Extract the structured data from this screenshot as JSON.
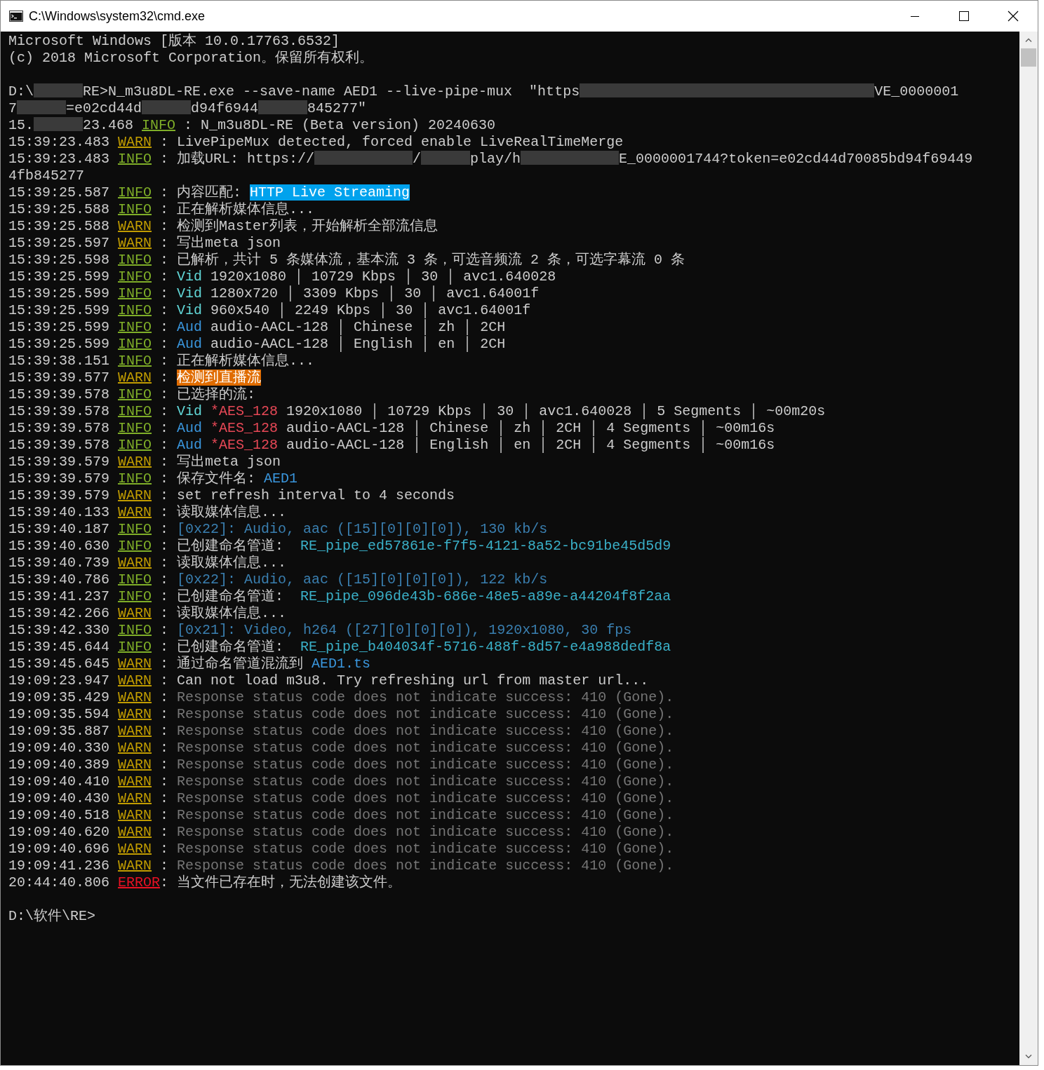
{
  "window": {
    "title": "C:\\Windows\\system32\\cmd.exe"
  },
  "console": {
    "blocks": [
      [
        {
          "segments": [
            {
              "kind": "txt",
              "text": "Microsoft Windows [版本 10.0.17763.6532]"
            }
          ]
        },
        {
          "segments": [
            {
              "kind": "txt",
              "text": "(c) 2018 Microsoft Corporation。保留所有权利。"
            }
          ]
        }
      ],
      [
        {
          "segments": [
            {
              "kind": "txt",
              "text": "D:\\"
            },
            {
              "kind": "redacted"
            },
            {
              "kind": "txt",
              "text": "RE>N_m3u8DL-RE.exe --save-name AED1 --live-pipe-mux  \"https"
            },
            {
              "kind": "redacted"
            },
            {
              "kind": "redacted"
            },
            {
              "kind": "redacted"
            },
            {
              "kind": "redacted"
            },
            {
              "kind": "redacted"
            },
            {
              "kind": "redacted"
            },
            {
              "kind": "txt",
              "text": "VE_0000001"
            }
          ]
        },
        {
          "segments": [
            {
              "kind": "txt",
              "text": "7"
            },
            {
              "kind": "redacted"
            },
            {
              "kind": "txt",
              "text": "=e02cd44d"
            },
            {
              "kind": "redacted"
            },
            {
              "kind": "txt",
              "text": "d94f6944"
            },
            {
              "kind": "redacted"
            },
            {
              "kind": "txt",
              "text": "845277\""
            }
          ]
        },
        {
          "segments": [
            {
              "kind": "txt",
              "text": "15."
            },
            {
              "kind": "redacted"
            },
            {
              "kind": "txt",
              "text": "23.468 "
            },
            {
              "kind": "info",
              "text": "INFO"
            },
            {
              "kind": "txt",
              "text": " : N_m3u8DL-RE (Beta version) 20240630"
            }
          ]
        },
        {
          "segments": [
            {
              "kind": "time",
              "text": "15:39:23.483 "
            },
            {
              "kind": "warn",
              "text": "WARN"
            },
            {
              "kind": "txt",
              "text": " : LivePipeMux detected, forced enable LiveRealTimeMerge"
            }
          ]
        },
        {
          "segments": [
            {
              "kind": "time",
              "text": "15:39:23.483 "
            },
            {
              "kind": "info",
              "text": "INFO"
            },
            {
              "kind": "txt",
              "text": " : 加载URL: https://"
            },
            {
              "kind": "redacted"
            },
            {
              "kind": "redacted"
            },
            {
              "kind": "txt",
              "text": "/"
            },
            {
              "kind": "redacted"
            },
            {
              "kind": "txt",
              "text": "play/h"
            },
            {
              "kind": "redacted"
            },
            {
              "kind": "redacted"
            },
            {
              "kind": "txt",
              "text": "E_0000001744?token=e02cd44d70085bd94f69449"
            }
          ]
        },
        {
          "segments": [
            {
              "kind": "txt",
              "text": "4fb845277"
            }
          ]
        },
        {
          "segments": [
            {
              "kind": "time",
              "text": "15:39:25.587 "
            },
            {
              "kind": "info",
              "text": "INFO"
            },
            {
              "kind": "txt",
              "text": " : 内容匹配: "
            },
            {
              "kind": "hl_blue",
              "text": "HTTP Live Streaming"
            }
          ]
        },
        {
          "segments": [
            {
              "kind": "time",
              "text": "15:39:25.588 "
            },
            {
              "kind": "info",
              "text": "INFO"
            },
            {
              "kind": "txt",
              "text": " : 正在解析媒体信息..."
            }
          ]
        },
        {
          "segments": [
            {
              "kind": "time",
              "text": "15:39:25.588 "
            },
            {
              "kind": "warn",
              "text": "WARN"
            },
            {
              "kind": "txt",
              "text": " : 检测到Master列表，开始解析全部流信息"
            }
          ]
        },
        {
          "segments": [
            {
              "kind": "time",
              "text": "15:39:25.597 "
            },
            {
              "kind": "warn",
              "text": "WARN"
            },
            {
              "kind": "txt",
              "text": " : 写出meta json"
            }
          ]
        },
        {
          "segments": [
            {
              "kind": "time",
              "text": "15:39:25.598 "
            },
            {
              "kind": "info",
              "text": "INFO"
            },
            {
              "kind": "txt",
              "text": " : 已解析，共计 5 条媒体流，基本流 3 条，可选音频流 2 条，可选字幕流 0 条"
            }
          ]
        },
        {
          "segments": [
            {
              "kind": "time",
              "text": "15:39:25.599 "
            },
            {
              "kind": "info",
              "text": "INFO"
            },
            {
              "kind": "txt",
              "text": " : "
            },
            {
              "kind": "vid",
              "text": "Vid"
            },
            {
              "kind": "txt",
              "text": " 1920x1080 │ 10729 Kbps │ 30 │ avc1.640028"
            }
          ]
        },
        {
          "segments": [
            {
              "kind": "time",
              "text": "15:39:25.599 "
            },
            {
              "kind": "info",
              "text": "INFO"
            },
            {
              "kind": "txt",
              "text": " : "
            },
            {
              "kind": "vid",
              "text": "Vid"
            },
            {
              "kind": "txt",
              "text": " 1280x720 │ 3309 Kbps │ 30 │ avc1.64001f"
            }
          ]
        },
        {
          "segments": [
            {
              "kind": "time",
              "text": "15:39:25.599 "
            },
            {
              "kind": "info",
              "text": "INFO"
            },
            {
              "kind": "txt",
              "text": " : "
            },
            {
              "kind": "vid",
              "text": "Vid"
            },
            {
              "kind": "txt",
              "text": " 960x540 │ 2249 Kbps │ 30 │ avc1.64001f"
            }
          ]
        },
        {
          "segments": [
            {
              "kind": "time",
              "text": "15:39:25.599 "
            },
            {
              "kind": "info",
              "text": "INFO"
            },
            {
              "kind": "txt",
              "text": " : "
            },
            {
              "kind": "aud",
              "text": "Aud"
            },
            {
              "kind": "txt",
              "text": " audio-AACL-128 │ Chinese │ zh │ 2CH"
            }
          ]
        },
        {
          "segments": [
            {
              "kind": "time",
              "text": "15:39:25.599 "
            },
            {
              "kind": "info",
              "text": "INFO"
            },
            {
              "kind": "txt",
              "text": " : "
            },
            {
              "kind": "aud",
              "text": "Aud"
            },
            {
              "kind": "txt",
              "text": " audio-AACL-128 │ English │ en │ 2CH"
            }
          ]
        },
        {
          "segments": [
            {
              "kind": "time",
              "text": "15:39:38.151 "
            },
            {
              "kind": "info",
              "text": "INFO"
            },
            {
              "kind": "txt",
              "text": " : 正在解析媒体信息..."
            }
          ]
        },
        {
          "segments": [
            {
              "kind": "time",
              "text": "15:39:39.577 "
            },
            {
              "kind": "warn",
              "text": "WARN"
            },
            {
              "kind": "txt",
              "text": " : "
            },
            {
              "kind": "hl_orange",
              "text": "检测到直播流"
            }
          ]
        },
        {
          "segments": [
            {
              "kind": "time",
              "text": "15:39:39.578 "
            },
            {
              "kind": "info",
              "text": "INFO"
            },
            {
              "kind": "txt",
              "text": " : 已选择的流:"
            }
          ]
        },
        {
          "segments": [
            {
              "kind": "time",
              "text": "15:39:39.578 "
            },
            {
              "kind": "info",
              "text": "INFO"
            },
            {
              "kind": "txt",
              "text": " : "
            },
            {
              "kind": "vid",
              "text": "Vid"
            },
            {
              "kind": "enc",
              "text": " *AES_128"
            },
            {
              "kind": "txt",
              "text": " 1920x1080 │ 10729 Kbps │ 30 │ avc1.640028 │ 5 Segments │ ~00m20s"
            }
          ]
        },
        {
          "segments": [
            {
              "kind": "time",
              "text": "15:39:39.578 "
            },
            {
              "kind": "info",
              "text": "INFO"
            },
            {
              "kind": "txt",
              "text": " : "
            },
            {
              "kind": "aud",
              "text": "Aud"
            },
            {
              "kind": "enc",
              "text": " *AES_128"
            },
            {
              "kind": "txt",
              "text": " audio-AACL-128 │ Chinese │ zh │ 2CH │ 4 Segments │ ~00m16s"
            }
          ]
        },
        {
          "segments": [
            {
              "kind": "time",
              "text": "15:39:39.578 "
            },
            {
              "kind": "info",
              "text": "INFO"
            },
            {
              "kind": "txt",
              "text": " : "
            },
            {
              "kind": "aud",
              "text": "Aud"
            },
            {
              "kind": "enc",
              "text": " *AES_128"
            },
            {
              "kind": "txt",
              "text": " audio-AACL-128 │ English │ en │ 2CH │ 4 Segments │ ~00m16s"
            }
          ]
        },
        {
          "segments": [
            {
              "kind": "time",
              "text": "15:39:39.579 "
            },
            {
              "kind": "warn",
              "text": "WARN"
            },
            {
              "kind": "txt",
              "text": " : 写出meta json"
            }
          ]
        },
        {
          "segments": [
            {
              "kind": "time",
              "text": "15:39:39.579 "
            },
            {
              "kind": "info",
              "text": "INFO"
            },
            {
              "kind": "txt",
              "text": " : 保存文件名: "
            },
            {
              "kind": "file",
              "text": "AED1"
            }
          ]
        },
        {
          "segments": [
            {
              "kind": "time",
              "text": "15:39:39.579 "
            },
            {
              "kind": "warn",
              "text": "WARN"
            },
            {
              "kind": "txt",
              "text": " : set refresh interval to 4 seconds"
            }
          ]
        },
        {
          "segments": [
            {
              "kind": "time",
              "text": "15:39:40.133 "
            },
            {
              "kind": "warn",
              "text": "WARN"
            },
            {
              "kind": "txt",
              "text": " : 读取媒体信息..."
            }
          ]
        },
        {
          "segments": [
            {
              "kind": "time",
              "text": "15:39:40.187 "
            },
            {
              "kind": "info",
              "text": "INFO"
            },
            {
              "kind": "txt",
              "text": " : "
            },
            {
              "kind": "meta",
              "text": "[0x22]: Audio, aac ([15][0][0][0]), 130 kb/s"
            }
          ]
        },
        {
          "segments": [
            {
              "kind": "time",
              "text": "15:39:40.630 "
            },
            {
              "kind": "info",
              "text": "INFO"
            },
            {
              "kind": "txt",
              "text": " : 已创建命名管道:  "
            },
            {
              "kind": "pipe",
              "text": "RE_pipe_ed57861e-f7f5-4121-8a52-bc91be45d5d9"
            }
          ]
        },
        {
          "segments": [
            {
              "kind": "time",
              "text": "15:39:40.739 "
            },
            {
              "kind": "warn",
              "text": "WARN"
            },
            {
              "kind": "txt",
              "text": " : 读取媒体信息..."
            }
          ]
        },
        {
          "segments": [
            {
              "kind": "time",
              "text": "15:39:40.786 "
            },
            {
              "kind": "info",
              "text": "INFO"
            },
            {
              "kind": "txt",
              "text": " : "
            },
            {
              "kind": "meta",
              "text": "[0x22]: Audio, aac ([15][0][0][0]), 122 kb/s"
            }
          ]
        },
        {
          "segments": [
            {
              "kind": "time",
              "text": "15:39:41.237 "
            },
            {
              "kind": "info",
              "text": "INFO"
            },
            {
              "kind": "txt",
              "text": " : 已创建命名管道:  "
            },
            {
              "kind": "pipe",
              "text": "RE_pipe_096de43b-686e-48e5-a89e-a44204f8f2aa"
            }
          ]
        },
        {
          "segments": [
            {
              "kind": "time",
              "text": "15:39:42.266 "
            },
            {
              "kind": "warn",
              "text": "WARN"
            },
            {
              "kind": "txt",
              "text": " : 读取媒体信息..."
            }
          ]
        },
        {
          "segments": [
            {
              "kind": "time",
              "text": "15:39:42.330 "
            },
            {
              "kind": "info",
              "text": "INFO"
            },
            {
              "kind": "txt",
              "text": " : "
            },
            {
              "kind": "meta",
              "text": "[0x21]: Video, h264 ([27][0][0][0]), 1920x1080, 30 fps"
            }
          ]
        },
        {
          "segments": [
            {
              "kind": "time",
              "text": "15:39:45.644 "
            },
            {
              "kind": "info",
              "text": "INFO"
            },
            {
              "kind": "txt",
              "text": " : 已创建命名管道:  "
            },
            {
              "kind": "pipe",
              "text": "RE_pipe_b404034f-5716-488f-8d57-e4a988dedf8a"
            }
          ]
        },
        {
          "segments": [
            {
              "kind": "time",
              "text": "15:39:45.645 "
            },
            {
              "kind": "warn",
              "text": "WARN"
            },
            {
              "kind": "txt",
              "text": " : 通过命名管道混流到 "
            },
            {
              "kind": "file",
              "text": "AED1.ts"
            }
          ]
        },
        {
          "segments": [
            {
              "kind": "time",
              "text": "19:09:23.947 "
            },
            {
              "kind": "warn",
              "text": "WARN"
            },
            {
              "kind": "txt",
              "text": " : Can not load m3u8. Try refreshing url from master url..."
            }
          ]
        },
        {
          "segments": [
            {
              "kind": "time",
              "text": "19:09:35.429 "
            },
            {
              "kind": "warn",
              "text": "WARN"
            },
            {
              "kind": "txt",
              "text": " : "
            },
            {
              "kind": "dim",
              "text": "Response status code does not indicate success: 410 (Gone)."
            }
          ]
        },
        {
          "segments": [
            {
              "kind": "time",
              "text": "19:09:35.594 "
            },
            {
              "kind": "warn",
              "text": "WARN"
            },
            {
              "kind": "txt",
              "text": " : "
            },
            {
              "kind": "dim",
              "text": "Response status code does not indicate success: 410 (Gone)."
            }
          ]
        },
        {
          "segments": [
            {
              "kind": "time",
              "text": "19:09:35.887 "
            },
            {
              "kind": "warn",
              "text": "WARN"
            },
            {
              "kind": "txt",
              "text": " : "
            },
            {
              "kind": "dim",
              "text": "Response status code does not indicate success: 410 (Gone)."
            }
          ]
        },
        {
          "segments": [
            {
              "kind": "time",
              "text": "19:09:40.330 "
            },
            {
              "kind": "warn",
              "text": "WARN"
            },
            {
              "kind": "txt",
              "text": " : "
            },
            {
              "kind": "dim",
              "text": "Response status code does not indicate success: 410 (Gone)."
            }
          ]
        },
        {
          "segments": [
            {
              "kind": "time",
              "text": "19:09:40.389 "
            },
            {
              "kind": "warn",
              "text": "WARN"
            },
            {
              "kind": "txt",
              "text": " : "
            },
            {
              "kind": "dim",
              "text": "Response status code does not indicate success: 410 (Gone)."
            }
          ]
        },
        {
          "segments": [
            {
              "kind": "time",
              "text": "19:09:40.410 "
            },
            {
              "kind": "warn",
              "text": "WARN"
            },
            {
              "kind": "txt",
              "text": " : "
            },
            {
              "kind": "dim",
              "text": "Response status code does not indicate success: 410 (Gone)."
            }
          ]
        },
        {
          "segments": [
            {
              "kind": "time",
              "text": "19:09:40.430 "
            },
            {
              "kind": "warn",
              "text": "WARN"
            },
            {
              "kind": "txt",
              "text": " : "
            },
            {
              "kind": "dim",
              "text": "Response status code does not indicate success: 410 (Gone)."
            }
          ]
        },
        {
          "segments": [
            {
              "kind": "time",
              "text": "19:09:40.518 "
            },
            {
              "kind": "warn",
              "text": "WARN"
            },
            {
              "kind": "txt",
              "text": " : "
            },
            {
              "kind": "dim",
              "text": "Response status code does not indicate success: 410 (Gone)."
            }
          ]
        },
        {
          "segments": [
            {
              "kind": "time",
              "text": "19:09:40.620 "
            },
            {
              "kind": "warn",
              "text": "WARN"
            },
            {
              "kind": "txt",
              "text": " : "
            },
            {
              "kind": "dim",
              "text": "Response status code does not indicate success: 410 (Gone)."
            }
          ]
        },
        {
          "segments": [
            {
              "kind": "time",
              "text": "19:09:40.696 "
            },
            {
              "kind": "warn",
              "text": "WARN"
            },
            {
              "kind": "txt",
              "text": " : "
            },
            {
              "kind": "dim",
              "text": "Response status code does not indicate success: 410 (Gone)."
            }
          ]
        },
        {
          "segments": [
            {
              "kind": "time",
              "text": "19:09:41.236 "
            },
            {
              "kind": "warn",
              "text": "WARN"
            },
            {
              "kind": "txt",
              "text": " : "
            },
            {
              "kind": "dim",
              "text": "Response status code does not indicate success: 410 (Gone)."
            }
          ]
        },
        {
          "segments": [
            {
              "kind": "time",
              "text": "20:44:40.806 "
            },
            {
              "kind": "error",
              "text": "ERROR"
            },
            {
              "kind": "txt",
              "text": ": 当文件已存在时，无法创建该文件。"
            }
          ]
        }
      ],
      [
        {
          "segments": [
            {
              "kind": "txt",
              "text": "D:\\软件\\RE>"
            }
          ]
        }
      ]
    ]
  }
}
